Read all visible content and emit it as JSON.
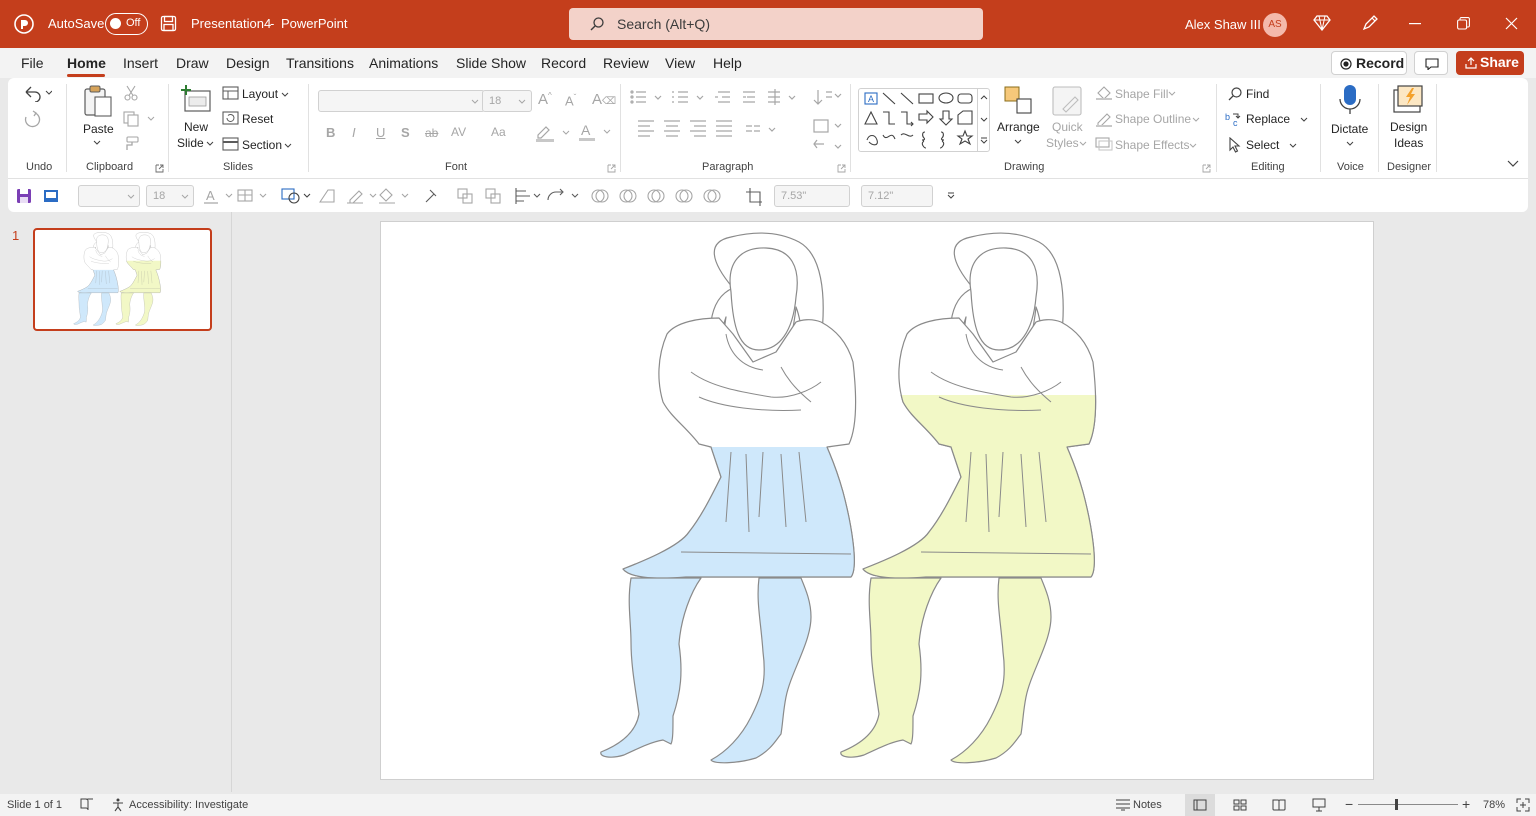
{
  "titlebar": {
    "autosave_label": "AutoSave",
    "autosave_state": "Off",
    "document_title": "Presentation4",
    "separator": "-",
    "app_name": "PowerPoint",
    "search_placeholder": "Search (Alt+Q)",
    "user_name": "Alex Shaw III",
    "user_initials": "AS",
    "accent_color": "#c43e1c"
  },
  "menu": {
    "tabs": [
      "File",
      "Home",
      "Insert",
      "Draw",
      "Design",
      "Transitions",
      "Animations",
      "Slide Show",
      "Record",
      "Review",
      "View",
      "Help"
    ],
    "active_tab": "Home",
    "record_button": "Record",
    "share_button": "Share"
  },
  "ribbon": {
    "undo": {
      "group_label": "Undo"
    },
    "clipboard": {
      "paste_label": "Paste",
      "group_label": "Clipboard"
    },
    "slides": {
      "new_slide_line1": "New",
      "new_slide_line2": "Slide",
      "layout": "Layout",
      "reset": "Reset",
      "section": "Section",
      "group_label": "Slides"
    },
    "font": {
      "font_size": "18",
      "bold": "B",
      "italic": "I",
      "underline": "U",
      "shadow": "S",
      "strike": "ab",
      "spacing": "AV",
      "case": "Aa",
      "group_label": "Font"
    },
    "paragraph": {
      "group_label": "Paragraph"
    },
    "drawing": {
      "arrange_label": "Arrange",
      "quick_styles_line1": "Quick",
      "quick_styles_line2": "Styles",
      "shape_fill": "Shape Fill",
      "shape_outline": "Shape Outline",
      "shape_effects": "Shape Effects",
      "group_label": "Drawing"
    },
    "editing": {
      "find": "Find",
      "replace": "Replace",
      "select": "Select",
      "group_label": "Editing"
    },
    "voice": {
      "dictate": "Dictate",
      "group_label": "Voice"
    },
    "designer": {
      "design_ideas_line1": "Design",
      "design_ideas_line2": "Ideas",
      "group_label": "Designer"
    }
  },
  "qat": {
    "font_size": "18",
    "width_value": "7.53\"",
    "height_value": "7.12\""
  },
  "thumbnails": [
    {
      "number": "1"
    }
  ],
  "slide": {
    "figures": [
      {
        "name": "blue-figure",
        "fill": "#cfe8fb"
      },
      {
        "name": "yellow-figure",
        "fill": "#f2f8c6"
      }
    ],
    "outline_color": "#8a8a8a"
  },
  "status": {
    "slide_counter": "Slide 1 of 1",
    "accessibility": "Accessibility: Investigate",
    "notes": "Notes",
    "zoom_level": "78%"
  }
}
